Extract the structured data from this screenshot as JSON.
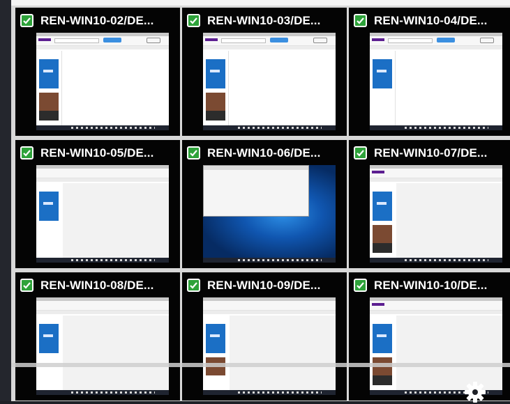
{
  "tiles": [
    {
      "title": "REN-WIN10-02/DE...",
      "checked": true,
      "screen": "browser"
    },
    {
      "title": "REN-WIN10-03/DE...",
      "checked": true,
      "screen": "browser"
    },
    {
      "title": "REN-WIN10-04/DE...",
      "checked": true,
      "screen": "browser"
    },
    {
      "title": "REN-WIN10-05/DE...",
      "checked": true,
      "screen": "browser"
    },
    {
      "title": "REN-WIN10-06/DE...",
      "checked": true,
      "screen": "desktop"
    },
    {
      "title": "REN-WIN10-07/DE...",
      "checked": true,
      "screen": "browser"
    },
    {
      "title": "REN-WIN10-08/DE...",
      "checked": true,
      "screen": "browser"
    },
    {
      "title": "REN-WIN10-09/DE...",
      "checked": true,
      "screen": "browser"
    },
    {
      "title": "REN-WIN10-10/DE...",
      "checked": true,
      "screen": "browser"
    }
  ],
  "colors": {
    "tile_background": "#040404",
    "checkbox_green": "#2ea23a",
    "title_text": "#ffffff",
    "grid_background": "#d8d8d8"
  },
  "icons": {
    "checkbox": "checkmark-icon",
    "settings": "gear-icon"
  }
}
